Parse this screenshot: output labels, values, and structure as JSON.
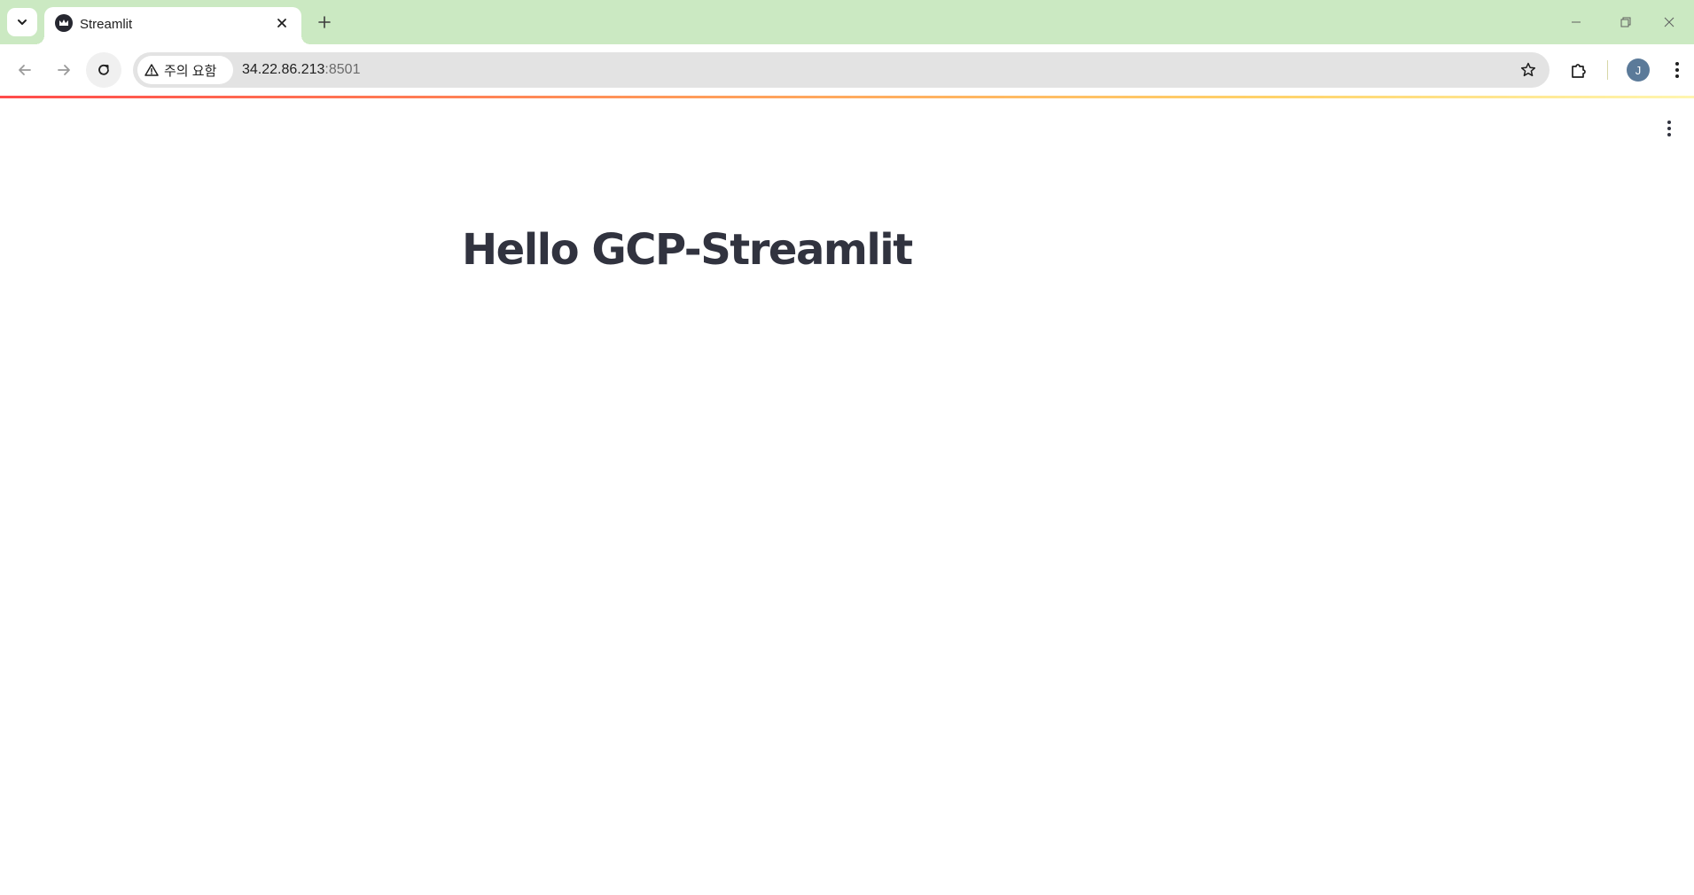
{
  "browser": {
    "tab": {
      "title": "Streamlit",
      "favicon": "streamlit-crown-icon"
    },
    "address_bar": {
      "security_chip_label": "주의 요함",
      "host": "34.22.86.213",
      "port": ":8501"
    },
    "profile_initial": "J",
    "colors": {
      "tabstrip": "#cbe9c2",
      "decoration_start": "#ff4b4b",
      "decoration_end": "#fff6b0"
    }
  },
  "app": {
    "title": "Hello GCP-Streamlit",
    "text_color": "#31333f"
  }
}
